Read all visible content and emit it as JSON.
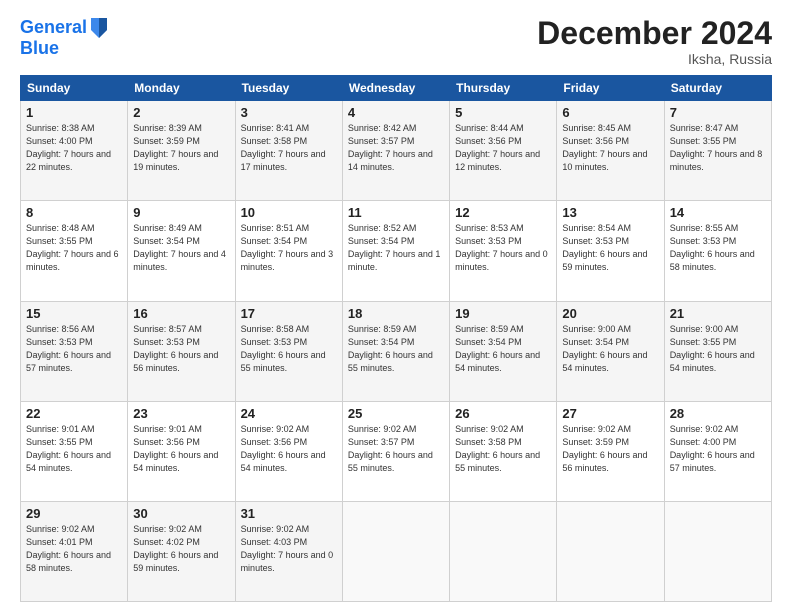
{
  "header": {
    "logo_line1": "General",
    "logo_line2": "Blue",
    "title": "December 2024",
    "subtitle": "Iksha, Russia"
  },
  "weekdays": [
    "Sunday",
    "Monday",
    "Tuesday",
    "Wednesday",
    "Thursday",
    "Friday",
    "Saturday"
  ],
  "weeks": [
    [
      {
        "day": "1",
        "sunrise": "Sunrise: 8:38 AM",
        "sunset": "Sunset: 4:00 PM",
        "daylight": "Daylight: 7 hours and 22 minutes."
      },
      {
        "day": "2",
        "sunrise": "Sunrise: 8:39 AM",
        "sunset": "Sunset: 3:59 PM",
        "daylight": "Daylight: 7 hours and 19 minutes."
      },
      {
        "day": "3",
        "sunrise": "Sunrise: 8:41 AM",
        "sunset": "Sunset: 3:58 PM",
        "daylight": "Daylight: 7 hours and 17 minutes."
      },
      {
        "day": "4",
        "sunrise": "Sunrise: 8:42 AM",
        "sunset": "Sunset: 3:57 PM",
        "daylight": "Daylight: 7 hours and 14 minutes."
      },
      {
        "day": "5",
        "sunrise": "Sunrise: 8:44 AM",
        "sunset": "Sunset: 3:56 PM",
        "daylight": "Daylight: 7 hours and 12 minutes."
      },
      {
        "day": "6",
        "sunrise": "Sunrise: 8:45 AM",
        "sunset": "Sunset: 3:56 PM",
        "daylight": "Daylight: 7 hours and 10 minutes."
      },
      {
        "day": "7",
        "sunrise": "Sunrise: 8:47 AM",
        "sunset": "Sunset: 3:55 PM",
        "daylight": "Daylight: 7 hours and 8 minutes."
      }
    ],
    [
      {
        "day": "8",
        "sunrise": "Sunrise: 8:48 AM",
        "sunset": "Sunset: 3:55 PM",
        "daylight": "Daylight: 7 hours and 6 minutes."
      },
      {
        "day": "9",
        "sunrise": "Sunrise: 8:49 AM",
        "sunset": "Sunset: 3:54 PM",
        "daylight": "Daylight: 7 hours and 4 minutes."
      },
      {
        "day": "10",
        "sunrise": "Sunrise: 8:51 AM",
        "sunset": "Sunset: 3:54 PM",
        "daylight": "Daylight: 7 hours and 3 minutes."
      },
      {
        "day": "11",
        "sunrise": "Sunrise: 8:52 AM",
        "sunset": "Sunset: 3:54 PM",
        "daylight": "Daylight: 7 hours and 1 minute."
      },
      {
        "day": "12",
        "sunrise": "Sunrise: 8:53 AM",
        "sunset": "Sunset: 3:53 PM",
        "daylight": "Daylight: 7 hours and 0 minutes."
      },
      {
        "day": "13",
        "sunrise": "Sunrise: 8:54 AM",
        "sunset": "Sunset: 3:53 PM",
        "daylight": "Daylight: 6 hours and 59 minutes."
      },
      {
        "day": "14",
        "sunrise": "Sunrise: 8:55 AM",
        "sunset": "Sunset: 3:53 PM",
        "daylight": "Daylight: 6 hours and 58 minutes."
      }
    ],
    [
      {
        "day": "15",
        "sunrise": "Sunrise: 8:56 AM",
        "sunset": "Sunset: 3:53 PM",
        "daylight": "Daylight: 6 hours and 57 minutes."
      },
      {
        "day": "16",
        "sunrise": "Sunrise: 8:57 AM",
        "sunset": "Sunset: 3:53 PM",
        "daylight": "Daylight: 6 hours and 56 minutes."
      },
      {
        "day": "17",
        "sunrise": "Sunrise: 8:58 AM",
        "sunset": "Sunset: 3:53 PM",
        "daylight": "Daylight: 6 hours and 55 minutes."
      },
      {
        "day": "18",
        "sunrise": "Sunrise: 8:59 AM",
        "sunset": "Sunset: 3:54 PM",
        "daylight": "Daylight: 6 hours and 55 minutes."
      },
      {
        "day": "19",
        "sunrise": "Sunrise: 8:59 AM",
        "sunset": "Sunset: 3:54 PM",
        "daylight": "Daylight: 6 hours and 54 minutes."
      },
      {
        "day": "20",
        "sunrise": "Sunrise: 9:00 AM",
        "sunset": "Sunset: 3:54 PM",
        "daylight": "Daylight: 6 hours and 54 minutes."
      },
      {
        "day": "21",
        "sunrise": "Sunrise: 9:00 AM",
        "sunset": "Sunset: 3:55 PM",
        "daylight": "Daylight: 6 hours and 54 minutes."
      }
    ],
    [
      {
        "day": "22",
        "sunrise": "Sunrise: 9:01 AM",
        "sunset": "Sunset: 3:55 PM",
        "daylight": "Daylight: 6 hours and 54 minutes."
      },
      {
        "day": "23",
        "sunrise": "Sunrise: 9:01 AM",
        "sunset": "Sunset: 3:56 PM",
        "daylight": "Daylight: 6 hours and 54 minutes."
      },
      {
        "day": "24",
        "sunrise": "Sunrise: 9:02 AM",
        "sunset": "Sunset: 3:56 PM",
        "daylight": "Daylight: 6 hours and 54 minutes."
      },
      {
        "day": "25",
        "sunrise": "Sunrise: 9:02 AM",
        "sunset": "Sunset: 3:57 PM",
        "daylight": "Daylight: 6 hours and 55 minutes."
      },
      {
        "day": "26",
        "sunrise": "Sunrise: 9:02 AM",
        "sunset": "Sunset: 3:58 PM",
        "daylight": "Daylight: 6 hours and 55 minutes."
      },
      {
        "day": "27",
        "sunrise": "Sunrise: 9:02 AM",
        "sunset": "Sunset: 3:59 PM",
        "daylight": "Daylight: 6 hours and 56 minutes."
      },
      {
        "day": "28",
        "sunrise": "Sunrise: 9:02 AM",
        "sunset": "Sunset: 4:00 PM",
        "daylight": "Daylight: 6 hours and 57 minutes."
      }
    ],
    [
      {
        "day": "29",
        "sunrise": "Sunrise: 9:02 AM",
        "sunset": "Sunset: 4:01 PM",
        "daylight": "Daylight: 6 hours and 58 minutes."
      },
      {
        "day": "30",
        "sunrise": "Sunrise: 9:02 AM",
        "sunset": "Sunset: 4:02 PM",
        "daylight": "Daylight: 6 hours and 59 minutes."
      },
      {
        "day": "31",
        "sunrise": "Sunrise: 9:02 AM",
        "sunset": "Sunset: 4:03 PM",
        "daylight": "Daylight: 7 hours and 0 minutes."
      },
      null,
      null,
      null,
      null
    ]
  ]
}
